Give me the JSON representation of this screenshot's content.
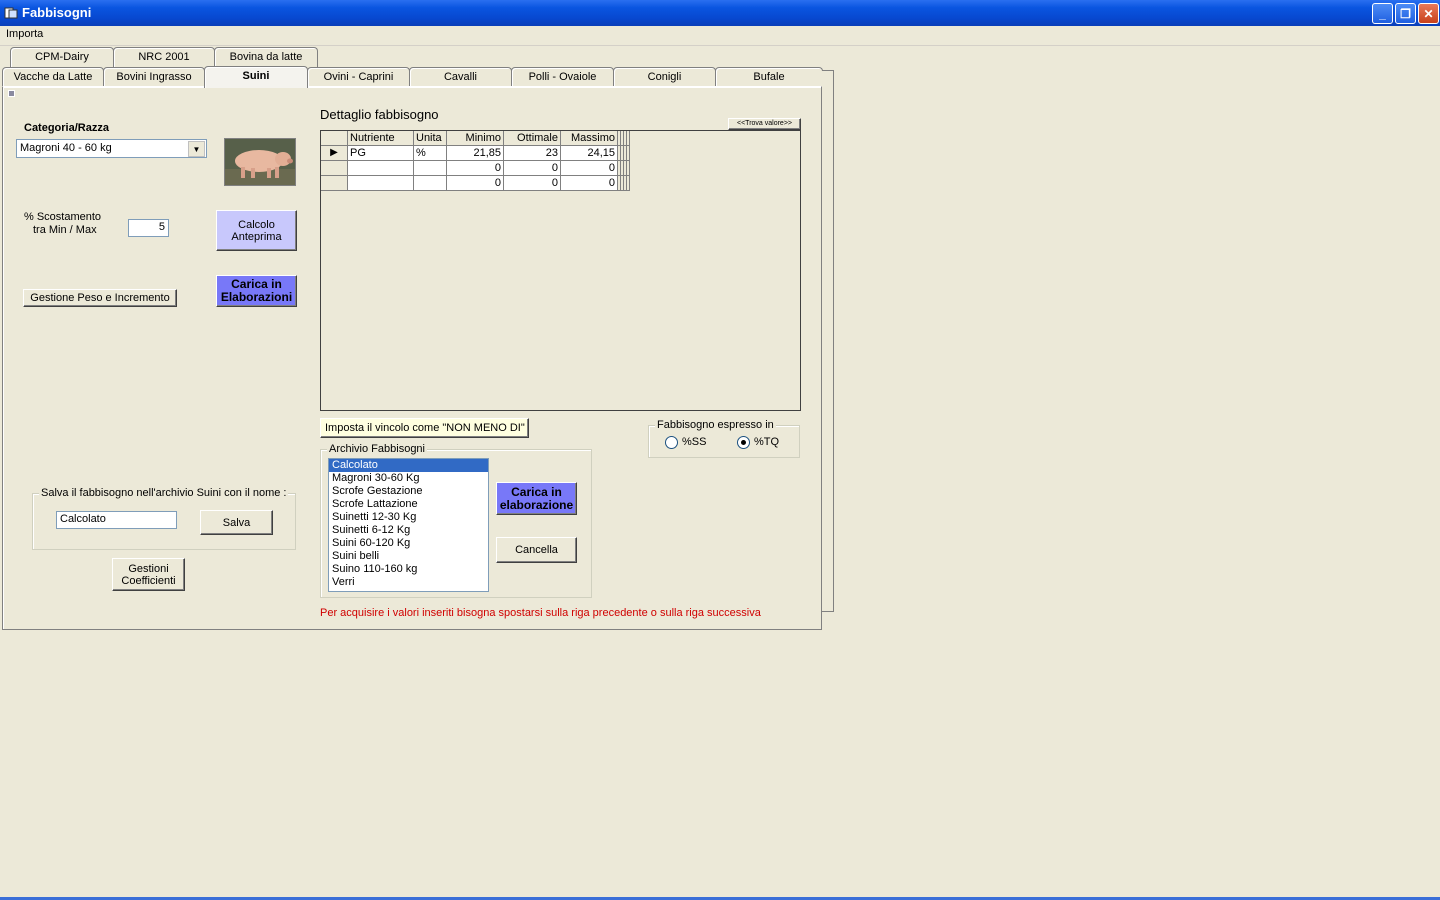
{
  "window": {
    "title": "Fabbisogni",
    "minimize_glyph": "_",
    "restore_glyph": "❐",
    "close_glyph": "✕"
  },
  "menu": {
    "importa": "Importa"
  },
  "tabs_row1": [
    "CPM-Dairy",
    "NRC 2001",
    "Bovina da latte"
  ],
  "tabs_row2": [
    "Vacche da Latte",
    "Bovini Ingrasso",
    "Suini",
    "Ovini  - Caprini",
    "Cavalli",
    "Polli - Ovaiole",
    "Conigli",
    "Bufale"
  ],
  "left": {
    "categoria_label": "Categoria/Razza",
    "categoria_value": "Magroni 40 - 60 kg",
    "scostamento_label_1": "%  Scostamento",
    "scostamento_label_2": "tra Min / Max",
    "scostamento_value": "5",
    "calcolo_btn": "Calcolo Anteprima",
    "carica_btn": "Carica in Elaborazioni",
    "gestione_btn": "Gestione Peso e Incremento",
    "salva_frame_title": "Salva il fabbisogno nell'archivio Suini con il nome :",
    "salva_value": "Calcolato",
    "salva_btn": "Salva",
    "gestioni_btn": "Gestioni Coefficienti"
  },
  "detail": {
    "title": "Dettaglio fabbisogno",
    "small_btn": "<<Trova valore>>",
    "columns": [
      "Nutriente",
      "Unita",
      "Minimo",
      "Ottimale",
      "Massimo"
    ],
    "rows": [
      [
        "PG",
        "%",
        "21,85",
        "23",
        "24,15"
      ],
      [
        "",
        "",
        "0",
        "0",
        "0"
      ],
      [
        "",
        "",
        "0",
        "0",
        "0"
      ]
    ],
    "row_indicator": "▶"
  },
  "vincolo_btn": "Imposta il vincolo come  \"NON MENO DI\"",
  "archivio": {
    "title": "Archivio Fabbisogni",
    "items": [
      "Calcolato",
      "Magroni 30-60 Kg",
      "Scrofe Gestazione",
      "Scrofe Lattazione",
      "Suinetti 12-30 Kg",
      "Suinetti 6-12 Kg",
      "Suini 60-120 Kg",
      "Suini belli",
      "Suino 110-160 kg",
      "Verri"
    ],
    "selected_index": 0,
    "carica_btn": "Carica in elaborazione",
    "cancella_btn": "Cancella"
  },
  "espresso": {
    "title": "Fabbisogno espresso in",
    "opt_ss": "%SS",
    "opt_tq": "%TQ",
    "selected": "%TQ"
  },
  "hint": "Per acquisire i valori inseriti bisogna spostarsi sulla riga precedente o sulla riga successiva",
  "colors": {
    "hint": "#d00000",
    "titlebar": "#0a55e0",
    "selected": "#316ac5"
  }
}
